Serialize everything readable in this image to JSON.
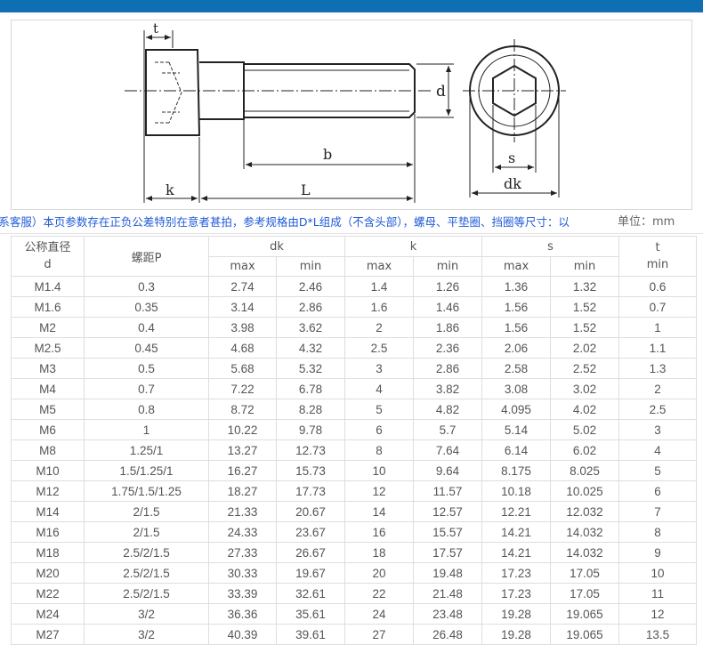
{
  "labels": {
    "t": "t",
    "d": "d",
    "b": "b",
    "k": "k",
    "L": "L",
    "s": "s",
    "dk": "dk"
  },
  "notice": "（如需特殊规格及非标定制，请联系客服）本页参数存在正负公差特别在意者甚拍，参考规格由D*L组成（不含头部），螺母、平垫圈、挡圈等尺寸：以",
  "unit": "单位：mm",
  "table": {
    "headers": {
      "nominal_line1": "公称直径",
      "nominal_line2": "d",
      "pitch": "螺距P",
      "dk": "dk",
      "k": "k",
      "s": "s",
      "t_line1": "t",
      "t_line2": "min",
      "max": "max",
      "min": "min"
    },
    "rows": [
      [
        "M1.4",
        "0.3",
        "2.74",
        "2.46",
        "1.4",
        "1.26",
        "1.36",
        "1.32",
        "0.6"
      ],
      [
        "M1.6",
        "0.35",
        "3.14",
        "2.86",
        "1.6",
        "1.46",
        "1.56",
        "1.52",
        "0.7"
      ],
      [
        "M2",
        "0.4",
        "3.98",
        "3.62",
        "2",
        "1.86",
        "1.56",
        "1.52",
        "1"
      ],
      [
        "M2.5",
        "0.45",
        "4.68",
        "4.32",
        "2.5",
        "2.36",
        "2.06",
        "2.02",
        "1.1"
      ],
      [
        "M3",
        "0.5",
        "5.68",
        "5.32",
        "3",
        "2.86",
        "2.58",
        "2.52",
        "1.3"
      ],
      [
        "M4",
        "0.7",
        "7.22",
        "6.78",
        "4",
        "3.82",
        "3.08",
        "3.02",
        "2"
      ],
      [
        "M5",
        "0.8",
        "8.72",
        "8.28",
        "5",
        "4.82",
        "4.095",
        "4.02",
        "2.5"
      ],
      [
        "M6",
        "1",
        "10.22",
        "9.78",
        "6",
        "5.7",
        "5.14",
        "5.02",
        "3"
      ],
      [
        "M8",
        "1.25/1",
        "13.27",
        "12.73",
        "8",
        "7.64",
        "6.14",
        "6.02",
        "4"
      ],
      [
        "M10",
        "1.5/1.25/1",
        "16.27",
        "15.73",
        "10",
        "9.64",
        "8.175",
        "8.025",
        "5"
      ],
      [
        "M12",
        "1.75/1.5/1.25",
        "18.27",
        "17.73",
        "12",
        "11.57",
        "10.18",
        "10.025",
        "6"
      ],
      [
        "M14",
        "2/1.5",
        "21.33",
        "20.67",
        "14",
        "12.57",
        "12.21",
        "12.032",
        "7"
      ],
      [
        "M16",
        "2/1.5",
        "24.33",
        "23.67",
        "16",
        "15.57",
        "14.21",
        "14.032",
        "8"
      ],
      [
        "M18",
        "2.5/2/1.5",
        "27.33",
        "26.67",
        "18",
        "17.57",
        "14.21",
        "14.032",
        "9"
      ],
      [
        "M20",
        "2.5/2/1.5",
        "30.33",
        "19.67",
        "20",
        "19.48",
        "17.23",
        "17.05",
        "10"
      ],
      [
        "M22",
        "2.5/2/1.5",
        "33.39",
        "32.61",
        "22",
        "21.48",
        "17.23",
        "17.05",
        "11"
      ],
      [
        "M24",
        "3/2",
        "36.36",
        "35.61",
        "24",
        "23.48",
        "19.28",
        "19.065",
        "12"
      ],
      [
        "M27",
        "3/2",
        "40.39",
        "39.61",
        "27",
        "26.48",
        "19.28",
        "19.065",
        "13.5"
      ]
    ]
  }
}
